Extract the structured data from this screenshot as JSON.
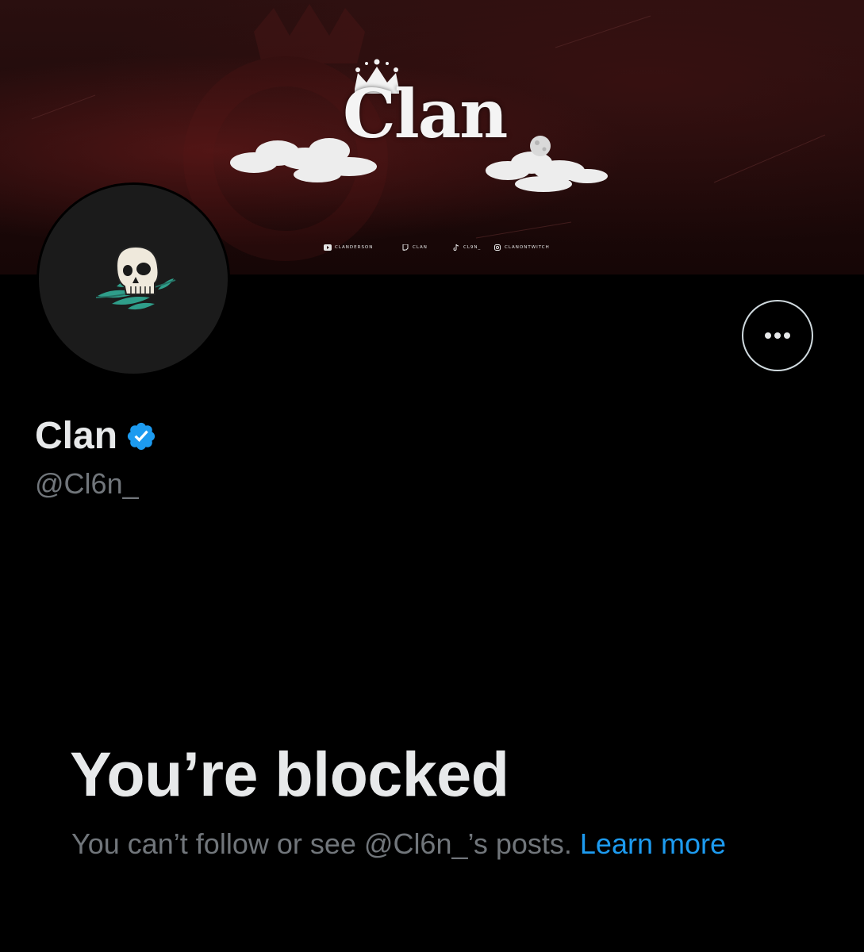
{
  "banner": {
    "title": "Clan",
    "socials": [
      {
        "icon": "youtube-icon",
        "label": "CLANDERSON"
      },
      {
        "icon": "twitch-icon",
        "label": "CLAN"
      },
      {
        "icon": "tiktok-icon",
        "label": "CL9N_"
      },
      {
        "icon": "instagram-icon",
        "label": "CLANONTWITCH"
      }
    ]
  },
  "avatar": {
    "icon": "skull-leaf-icon"
  },
  "profile": {
    "display_name": "Clan",
    "verified_icon": "verified-badge-icon",
    "handle": "@Cl6n_"
  },
  "more_button": {
    "icon": "more-dots-icon"
  },
  "blocked": {
    "title": "You’re blocked",
    "description": "You can’t follow or see @Cl6n_’s posts. ",
    "link_label": "Learn more"
  },
  "colors": {
    "background": "#000000",
    "primary_text": "#e7e9ea",
    "secondary_text": "#71767b",
    "link": "#1d9bf0",
    "verified": "#1d9bf0"
  }
}
